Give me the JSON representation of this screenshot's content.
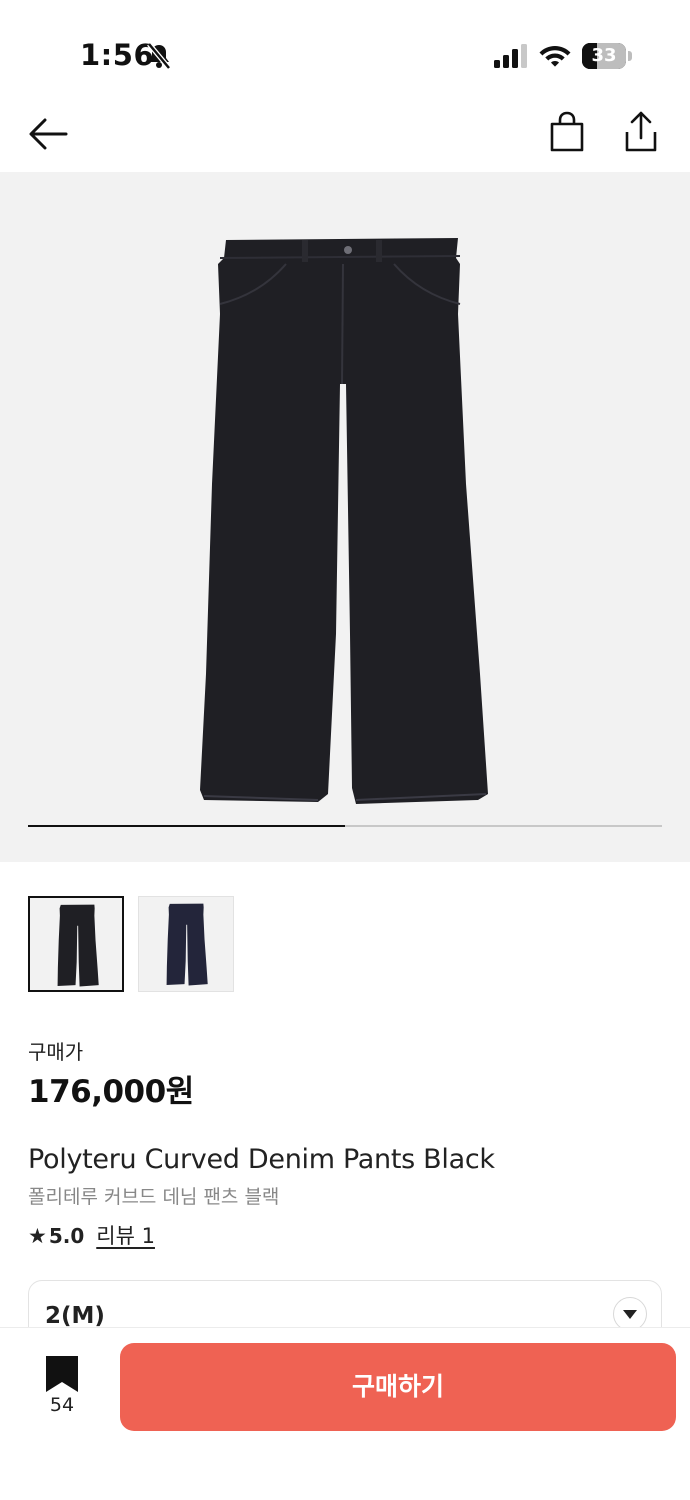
{
  "status_bar": {
    "time": "1:56",
    "battery_level": "33",
    "battery_fraction": 0.33
  },
  "nav": {
    "back_icon": "arrow-left-icon",
    "bag_icon": "shopping-bag-icon",
    "share_icon": "share-icon"
  },
  "gallery": {
    "progress_fraction": 0.5,
    "thumbnails": [
      {
        "selected": true,
        "color": "#1f1f24"
      },
      {
        "selected": false,
        "color": "#23253a"
      }
    ]
  },
  "product": {
    "price_label": "구매가",
    "price": "176,000원",
    "name_en": "Polyteru Curved Denim Pants Black",
    "name_ko": "폴리테루 커브드 데님 팬츠 블랙",
    "rating_star": "★",
    "rating": "5.0",
    "review_link": "리뷰 1"
  },
  "option": {
    "selected": "2(M)"
  },
  "bottom_bar": {
    "bookmark_count": "54",
    "buy_label": "구매하기"
  },
  "colors": {
    "accent": "#ef6253",
    "background": "#ffffff",
    "image_background": "#f2f2f2",
    "denim": "#1f1f24"
  }
}
